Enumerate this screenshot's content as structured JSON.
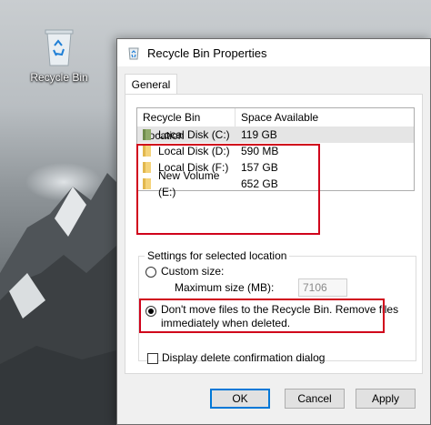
{
  "desktop": {
    "icon_label": "Recycle Bin",
    "icon": "recycle-bin-icon"
  },
  "dialog": {
    "title": "Recycle Bin Properties",
    "title_icon": "recycle-bin-icon",
    "tab": "General",
    "list": {
      "columns": [
        "Recycle Bin Location",
        "Space Available"
      ],
      "rows": [
        {
          "location": "Local Disk (C:)",
          "space": "119 GB",
          "selected": true
        },
        {
          "location": "Local Disk (D:)",
          "space": "590 MB",
          "selected": false
        },
        {
          "location": "Local Disk (F:)",
          "space": "157 GB",
          "selected": false
        },
        {
          "location": "New Volume (E:)",
          "space": "652 GB",
          "selected": false
        }
      ]
    },
    "settings": {
      "group_label": "Settings for selected location",
      "custom_size_label": "Custom size:",
      "max_size_label": "Maximum size (MB):",
      "max_size_value": "7106",
      "dont_move_line1": "Don't move files to the Recycle Bin. Remove files",
      "dont_move_line2": "immediately when deleted.",
      "custom_size_selected": false,
      "dont_move_selected": true
    },
    "confirm_label": "Display delete confirmation dialog",
    "confirm_checked": false,
    "buttons": {
      "ok": "OK",
      "cancel": "Cancel",
      "apply": "Apply"
    }
  },
  "colors": {
    "highlight": "#d0021b",
    "accent": "#0078d7"
  }
}
